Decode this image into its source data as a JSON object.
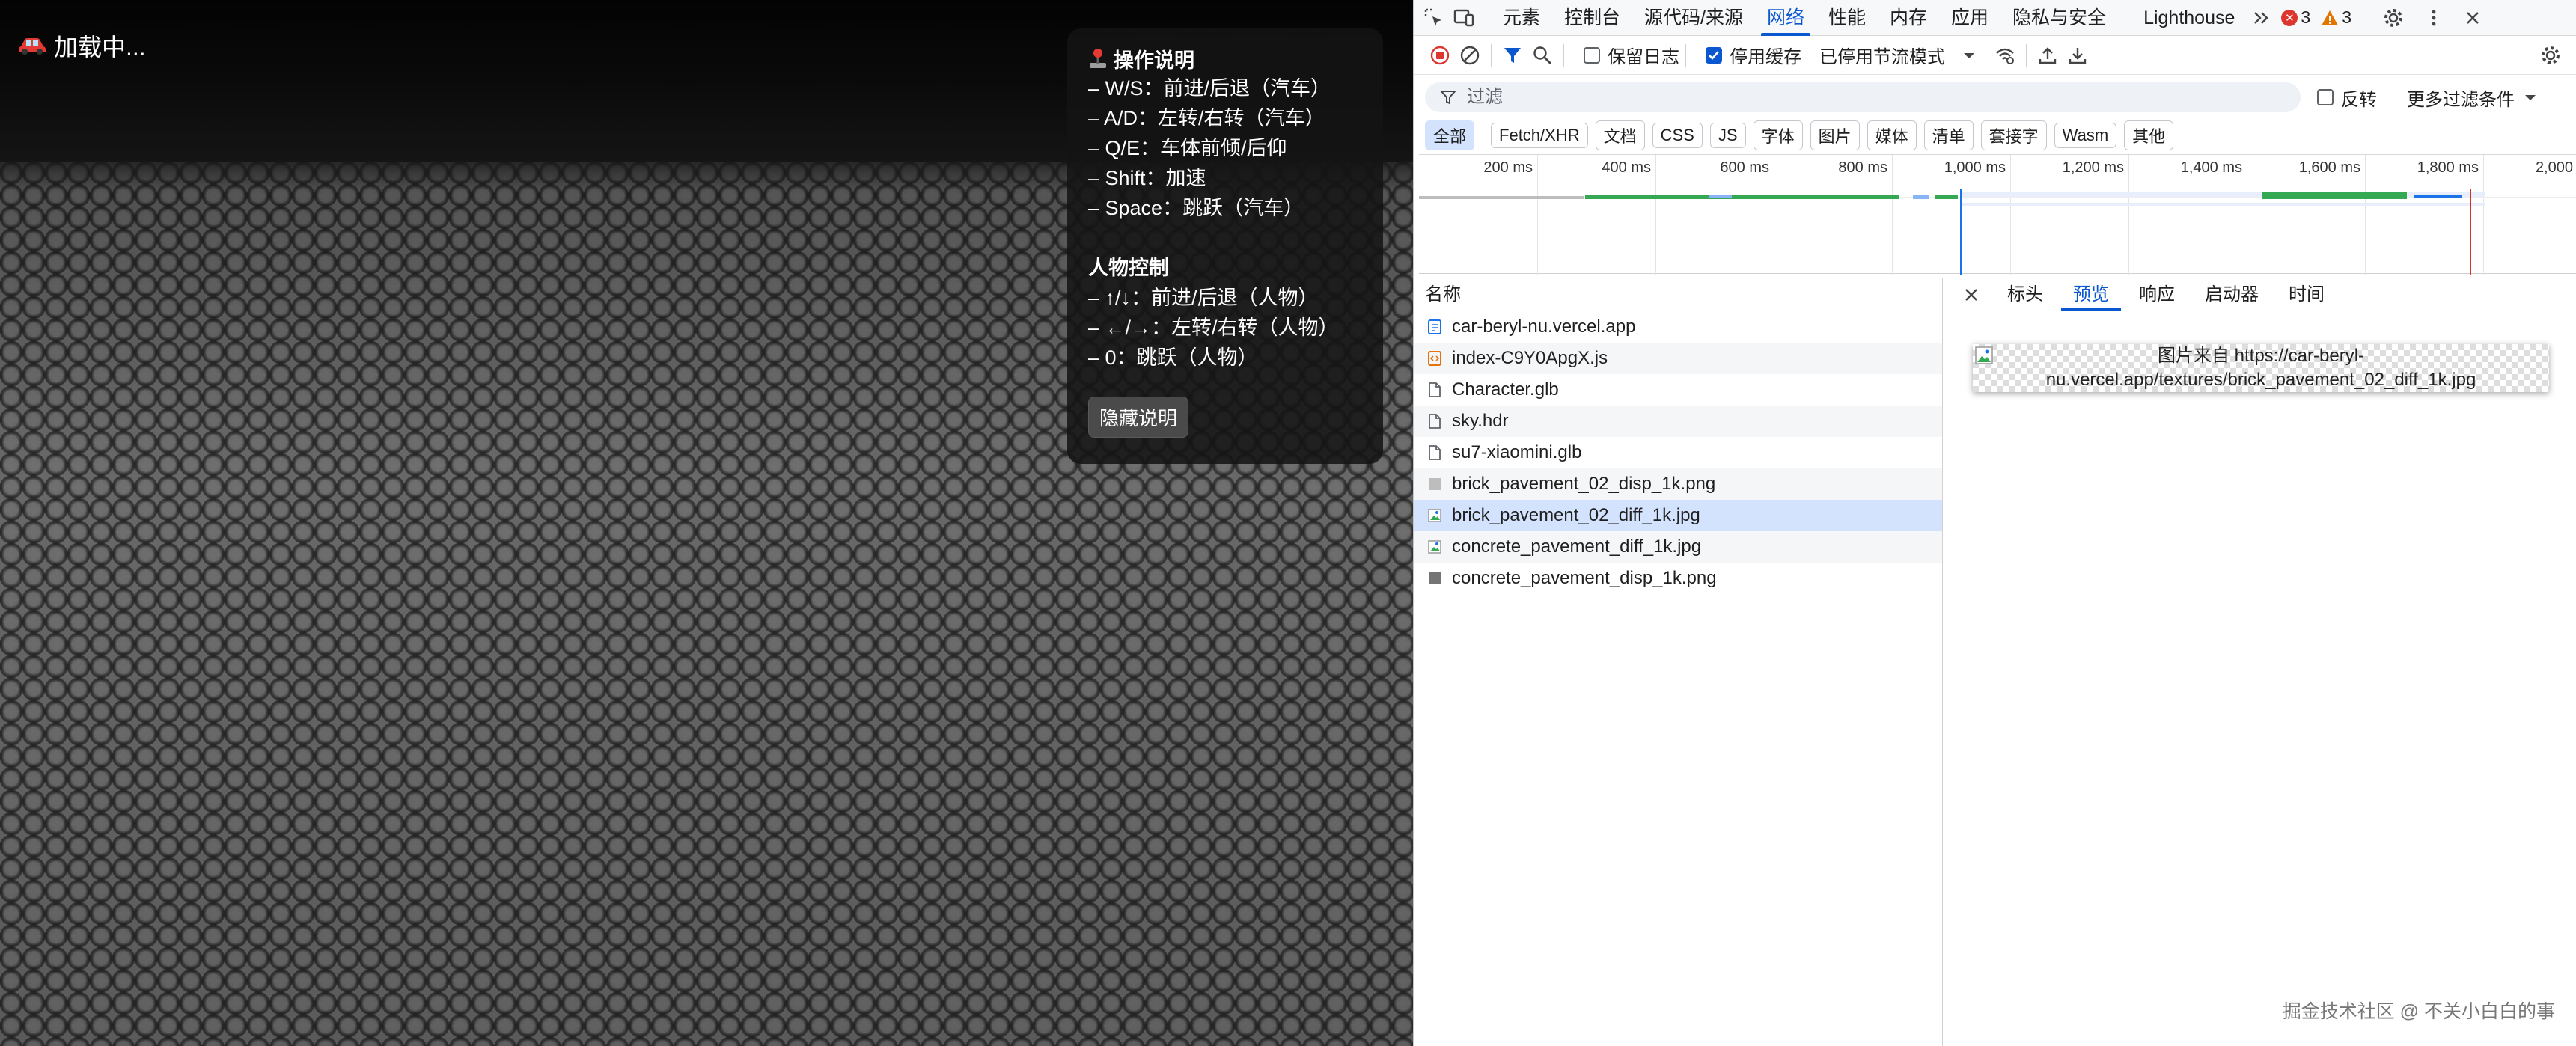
{
  "game": {
    "loading_text": "加载中...",
    "help": {
      "title": "操作说明",
      "car_lines": [
        "– W/S：前进/后退（汽车）",
        "– A/D：左转/右转（汽车）",
        "– Q/E：车体前倾/后仰",
        "– Shift：加速",
        "– Space：跳跃（汽车）"
      ],
      "person_title": "人物控制",
      "person_lines": [
        "– ↑/↓：前进/后退（人物）",
        "– ←/→：左转/右转（人物）",
        "– 0：跳跃（人物）"
      ],
      "hide_button": "隐藏说明"
    }
  },
  "devtools": {
    "tabs": [
      "元素",
      "控制台",
      "源代码/来源",
      "网络",
      "性能",
      "内存",
      "应用",
      "隐私与安全",
      "Lighthouse"
    ],
    "active_tab": "网络",
    "errors": "3",
    "warnings": "3",
    "toolbar": {
      "preserve_log": "保留日志",
      "disable_cache": "停用缓存",
      "throttle": "已停用节流模式"
    },
    "filter": {
      "placeholder": "过滤",
      "invert": "反转",
      "more_filters": "更多过滤条件"
    },
    "type_filters": [
      "全部",
      "Fetch/XHR",
      "文档",
      "CSS",
      "JS",
      "字体",
      "图片",
      "媒体",
      "清单",
      "套接字",
      "Wasm",
      "其他"
    ],
    "timeline_ticks": [
      "200 ms",
      "400 ms",
      "600 ms",
      "800 ms",
      "1,000 ms",
      "1,200 ms",
      "1,400 ms",
      "1,600 ms",
      "1,800 ms",
      "2,000"
    ],
    "request_header": "名称",
    "requests": [
      {
        "name": "car-beryl-nu.vercel.app",
        "icon": "document-icon"
      },
      {
        "name": "index-C9Y0ApgX.js",
        "icon": "script-icon"
      },
      {
        "name": "Character.glb",
        "icon": "file-icon"
      },
      {
        "name": "sky.hdr",
        "icon": "file-icon"
      },
      {
        "name": "su7-xiaomini.glb",
        "icon": "file-icon"
      },
      {
        "name": "brick_pavement_02_disp_1k.png",
        "icon": "image-gray-icon"
      },
      {
        "name": "brick_pavement_02_diff_1k.jpg",
        "icon": "image-icon"
      },
      {
        "name": "concrete_pavement_diff_1k.jpg",
        "icon": "image-icon"
      },
      {
        "name": "concrete_pavement_disp_1k.png",
        "icon": "image-dark-icon"
      }
    ],
    "selected_request": "brick_pavement_02_diff_1k.jpg",
    "details_tabs": [
      "标头",
      "预览",
      "响应",
      "启动器",
      "时间"
    ],
    "active_details_tab": "预览",
    "preview_alt_line1": "图片来自 https://car-beryl-",
    "preview_alt_line2": "nu.vercel.app/textures/brick_pavement_02_diff_1k.jpg",
    "watermark": "掘金技术社区 @ 不关小白白的事"
  },
  "colors": {
    "accent": "#0b57d0",
    "error": "#dc362e",
    "warning": "#e37400",
    "selected_row": "#d3e3fd"
  }
}
